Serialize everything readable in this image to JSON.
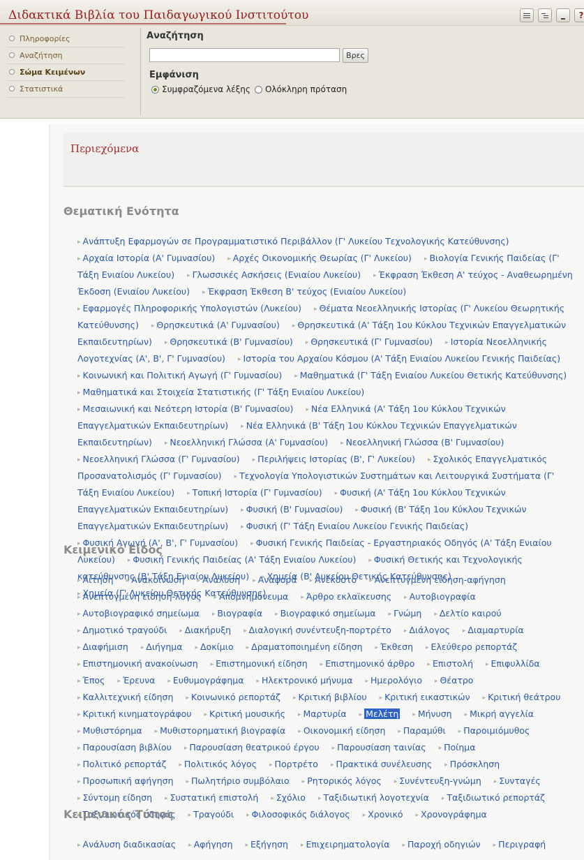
{
  "site": {
    "title": "Διδακτικά Βιβλία του Παιδαγωγικού Ινστιτούτου",
    "toolbar_icons": [
      "list-view-icon",
      "tree-view-icon",
      "minimize-icon",
      "help-icon"
    ]
  },
  "nav": {
    "items": [
      {
        "label": "Πληροφορίες",
        "active": false
      },
      {
        "label": "Αναζήτηση",
        "active": false
      },
      {
        "label": "Σώμα Κειμένων",
        "active": true
      },
      {
        "label": "Στατιστικά",
        "active": false
      }
    ]
  },
  "search": {
    "title": "Αναζήτηση",
    "input_value": "",
    "button_label": "Βρες",
    "display_title": "Εμφάνιση",
    "option_context": "Συμφραζόμενα λέξης",
    "option_sentence": "Ολόκληρη πρόταση",
    "selected": "context"
  },
  "contents": {
    "title": "Περιεχόμενα"
  },
  "sections": [
    {
      "heading": "Θεματική Ενότητα",
      "items": [
        "Ανάπτυξη Εφαρμογών σε Προγραμματιστικό Περιβάλλον (Γ' Λυκείου Τεχνολογικής Κατεύθυνσης)",
        "Αρχαία Ιστορία (Α' Γυμνασίου)",
        "Αρχές Οικονομικής Θεωρίας (Γ' Λυκείου)",
        "Βιολογία Γενικής Παιδείας (Γ' Τάξη Ενιαίου Λυκείου)",
        "Γλωσσικές Ασκήσεις (Ενιαίου Λυκείου)",
        "Έκφραση Έκθεση Α' τεύχος - Αναθεωρημένη Έκδοση (Ενιαίου Λυκείου)",
        "Έκφραση Έκθεση Β' τεύχος (Ενιαίου Λυκείου)",
        "Εφαρμογές Πληροφορικής Υπολογιστών (Λυκείου)",
        "Θέματα Νεοελληνικής Ιστορίας (Γ' Λυκείου Θεωρητικής Κατεύθυνσης)",
        "Θρησκευτικά (Α' Γυμνασίου)",
        "Θρησκευτικά (Α' Τάξη 1ου Κύκλου Τεχνικών Επαγγελματικών Εκπαιδευτηρίων)",
        "Θρησκευτικά (Β' Γυμνασίου)",
        "Θρησκευτικά (Γ' Γυμνασίου)",
        "Ιστορία Νεοελληνικής Λογοτεχνίας (Α', Β', Γ' Γυμνασίου)",
        "Ιστορία του Αρχαίου Κόσμου (Α' Τάξη Ενιαίου Λυκείου Γενικής Παιδείας)",
        "Κοινωνική και Πολιτική Αγωγή (Γ' Γυμνασίου)",
        "Μαθηματικά (Γ' Τάξη Ενιαίου Λυκείου Θετικής Κατεύθυνσης)",
        "Μαθηματικά και Στοιχεία Στατιστικής (Γ' Τάξη Ενιαίου Λυκείου)",
        "Μεσαιωνική και Νεότερη Ιστορία (Β' Γυμνασίου)",
        "Νέα Ελληνικά (Α' Τάξη 1ου Κύκλου Τεχνικών Επαγγελματικών Εκπαιδευτηρίων)",
        "Νέα Ελληνικά (Β' Τάξη 1ου Κύκλου Τεχνικών Επαγγελματικών Εκπαιδευτηρίων)",
        "Νεοελληνική Γλώσσα (Α' Γυμνασίου)",
        "Νεοελληνική Γλώσσα (Β' Γυμνασίου)",
        "Νεοελληνική Γλώσσα (Γ' Γυμνασίου)",
        "Περιλήψεις Ιστορίας (Β', Γ' Λυκείου)",
        "Σχολικός Επαγγελματικός Προσανατολισμός (Γ' Γυμνασίου)",
        "Τεχνολογία Υπολογιστικών Συστημάτων και Λειτουργικά Συστήματα (Γ' Τάξη Ενιαίου Λυκείου)",
        "Τοπική Ιστορία (Γ' Γυμνασίου)",
        "Φυσική (Α' Τάξη 1ου Κύκλου Τεχνικών Επαγγελματικών Εκπαιδευτηρίων)",
        "Φυσική (Β' Γυμνασίου)",
        "Φυσική (Β' Τάξη 1ου Κύκλου Τεχνικών Επαγγελματικών Εκπαιδευτηρίων)",
        "Φυσική (Γ' Τάξη Ενιαίου Λυκείου Γενικής Παιδείας)",
        "Φυσική Αγωγή (Α', Β', Γ' Γυμνασίου)",
        "Φυσική Γενικής Παιδείας - Εργαστηριακός Οδηγός (Α' Τάξη Ενιαίου Λυκείου)",
        "Φυσική Γενικής Παιδείας (Α' Τάξη Ενιαίου Λυκείου)",
        "Φυσική Θετικής και Τεχνολογικής κατεύθυνσης (Β' Τάξη Ενιαίου Λυκείου)",
        "Χημεία (Β' Λυκείου Θετικής Κατεύθυνσης)",
        "Χημεία (Γ' Λυκείου Θετικής Κατεύθυνσης)"
      ]
    },
    {
      "heading": "Κειμενικό Είδος",
      "selected_index": 45,
      "items": [
        "Αίτηση",
        "Ανακοίνωση",
        "Ανάλυση",
        "Αναφορά",
        "Ανέκδοτο",
        "Ανεπτυγμένη είδηση-αφήγηση",
        "Ανεπτυγμένη είδηση-λόγος",
        "Απομνημόνευμα",
        "Άρθρο εκλαϊκευσης",
        "Αυτοβιογραφία",
        "Αυτοβιογραφικό σημείωμα",
        "Βιογραφία",
        "Βιογραφικό σημείωμα",
        "Γνώμη",
        "Δελτίο καιρού",
        "Δημοτικό τραγούδι",
        "Διακήρυξη",
        "Διαλογική συνέντευξη-πορτρέτο",
        "Διάλογος",
        "Διαμαρτυρία",
        "Διαφήμιση",
        "Διήγημα",
        "Δοκίμιο",
        "Δραματοποιημένη είδηση",
        "Έκθεση",
        "Ελεύθερο ρεπορτάζ",
        "Επιστημονική ανακοίνωση",
        "Επιστημονική είδηση",
        "Επιστημονικό άρθρο",
        "Επιστολή",
        "Επιφυλλίδα",
        "Έπος",
        "Έρευνα",
        "Ευθυμογράφημα",
        "Ηλεκτρονικό μήνυμα",
        "Ημερολόγιο",
        "Θέατρο",
        "Καλλιτεχνική είδηση",
        "Κοινωνικό ρεπορτάζ",
        "Κριτική βιβλίου",
        "Κριτική εικαστικών",
        "Κριτική θεάτρου",
        "Κριτική κινηματογράφου",
        "Κριτική μουσικής",
        "Μαρτυρία",
        "Μελέτη",
        "Μήνυση",
        "Μικρή αγγελία",
        "Μυθιστόρημα",
        "Μυθιστορηματική βιογραφία",
        "Οικονομική είδηση",
        "Παραμύθι",
        "Παροιμιόμυθος",
        "Παρουσίαση βιβλίου",
        "Παρουσίαση θεατρικού έργου",
        "Παρουσίαση ταινίας",
        "Ποίημα",
        "Πολιτικό ρεπορτάζ",
        "Πολιτικός λόγος",
        "Πορτρέτο",
        "Πρακτικά συνέλευσης",
        "Πρόσκληση",
        "Προσωπική αφήγηση",
        "Πωλητήριο συμβόλαιο",
        "Ρητορικός λόγος",
        "Συνέντευξη-γνώμη",
        "Συνταγές",
        "Σύντομη είδηση",
        "Συστατική επιστολή",
        "Σχόλιο",
        "Ταξιδιωτική λογοτεχνία",
        "Ταξιδιωτικό ρεπορτάζ",
        "Ταξιδιωτικός οδηγός",
        "Τραγούδι",
        "Φιλοσοφικός διάλογος",
        "Χρονικό",
        "Χρονογράφημα"
      ]
    },
    {
      "heading": "Κειμενικός Τύπος",
      "items": [
        "Ανάλυση διαδικασίας",
        "Αφήγηση",
        "Εξήγηση",
        "Επιχειρηματολογία",
        "Παροχή οδηγιών",
        "Περιγραφή"
      ]
    }
  ]
}
